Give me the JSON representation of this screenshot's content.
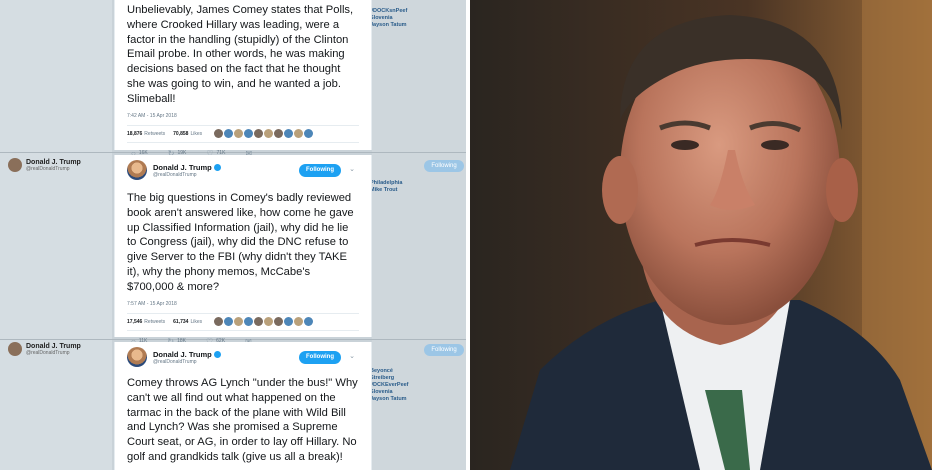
{
  "tweets": [
    {
      "text": "Unbelievably, James Comey states that Polls, where Crooked Hillary was leading, were a factor in the handling (stupidly) of the Clinton Email probe. In other words, he was making decisions based on the fact that he thought she was going to win, and he wanted a job. Slimeball!",
      "time": "7:42 AM - 15 Apr 2018",
      "retweets": "18,876",
      "retweets_label": "Retweets",
      "likes": "70,858",
      "likes_label": "Likes",
      "replies": "16K",
      "rts_short": "19K",
      "likes_short": "71K"
    },
    {
      "name": "Donald J. Trump",
      "handle": "@realDonaldTrump",
      "follow_label": "Following",
      "text": "The big questions in Comey's badly reviewed book aren't answered like, how come he gave up Classified Information (jail), why did he lie to Congress (jail), why did the DNC refuse to give Server to the FBI (why didn't they TAKE it), why the phony memos, McCabe's $700,000 & more?",
      "time": "7:57 AM - 15 Apr 2018",
      "retweets": "17,546",
      "retweets_label": "Retweets",
      "likes": "61,734",
      "likes_label": "Likes",
      "replies": "11K",
      "rts_short": "18K",
      "likes_short": "62K"
    },
    {
      "name": "Donald J. Trump",
      "handle": "@realDonaldTrump",
      "follow_label": "Following",
      "text": "Comey throws AG Lynch \"under the bus!\" Why can't we all find out what happened on the tarmac in the back of the plane with Wild Bill and Lynch? Was she promised a Supreme Court seat, or AG, in order to lay off Hillary. No golf and grandkids talk (give us all a break)!"
    }
  ],
  "background": {
    "name": "Donald J. Trump",
    "handle": "@realDonaldTrump",
    "follow_label": "Following",
    "side1": [
      "#DOCKsnPeef",
      "Slovenia",
      "Jayson Tatum"
    ],
    "side2": [
      "Philadelphia",
      "Mike Trout"
    ],
    "side3": [
      "Beyoncé",
      "Streiberg",
      "#DCKEverPeef",
      "Slovenia",
      "Jayson Tatum"
    ]
  },
  "photo": {
    "subject": "man-portrait",
    "suit_color": "#1f2a3a",
    "shirt_color": "#eef0f2",
    "tie_color": "#3a6a4a"
  }
}
